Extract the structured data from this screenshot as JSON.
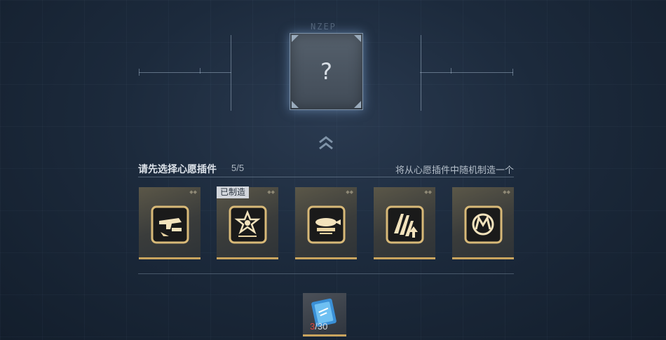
{
  "brand": "NZEP",
  "mystery": {
    "symbol": "?"
  },
  "header": {
    "title": "请先选择心愿插件",
    "count": "5/5",
    "hint": "将从心愿插件中随机制造一个"
  },
  "plugins": [
    {
      "name": "plugin-1",
      "icon": "gun-plugin-icon",
      "made": false
    },
    {
      "name": "plugin-2",
      "icon": "star-plugin-icon",
      "made": true
    },
    {
      "name": "plugin-3",
      "icon": "rocket-plugin-icon",
      "made": false
    },
    {
      "name": "plugin-4",
      "icon": "claw-plugin-icon",
      "made": false
    },
    {
      "name": "plugin-5",
      "icon": "mw-plugin-icon",
      "made": false
    }
  ],
  "made_label": "已制造",
  "material": {
    "icon": "blueprint-book-icon",
    "have": "3",
    "sep": "/",
    "need": "30"
  },
  "colors": {
    "gold": "#c9a45e",
    "accent_blue": "#8cb4e6",
    "red": "#e0443c"
  }
}
